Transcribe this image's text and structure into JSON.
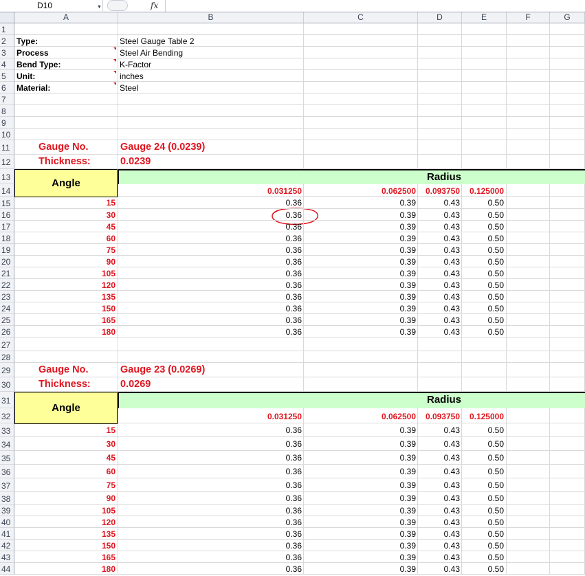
{
  "formula_bar": {
    "name_box": "D10",
    "fx_label": "fx"
  },
  "columns": [
    "A",
    "B",
    "C",
    "D",
    "E",
    "F",
    "G"
  ],
  "info": [
    {
      "label": "Type:",
      "value": "Steel Gauge Table 2",
      "flag": false
    },
    {
      "label": "Process",
      "value": "Steel Air Bending",
      "flag": true
    },
    {
      "label": "Bend Type:",
      "value": "K-Factor",
      "flag": true
    },
    {
      "label": "Unit:",
      "value": "inches",
      "flag": true
    },
    {
      "label": "Material:",
      "value": "Steel",
      "flag": true
    }
  ],
  "tables": [
    {
      "gauge_label": "Gauge No.",
      "gauge_value": "Gauge 24 (0.0239)",
      "thickness_label": "Thickness:",
      "thickness_value": "0.0239",
      "angle_header": "Angle",
      "radius_header": "Radius",
      "radii": [
        "0.031250",
        "0.062500",
        "0.093750",
        "0.125000"
      ],
      "angles": [
        "15",
        "30",
        "45",
        "60",
        "75",
        "90",
        "105",
        "120",
        "135",
        "150",
        "165",
        "180"
      ],
      "values": [
        "0.36",
        "0.39",
        "0.43",
        "0.50"
      ]
    },
    {
      "gauge_label": "Gauge No.",
      "gauge_value": "Gauge 23 (0.0269)",
      "thickness_label": "Thickness:",
      "thickness_value": "0.0269",
      "angle_header": "Angle",
      "radius_header": "Radius",
      "radii": [
        "0.031250",
        "0.062500",
        "0.093750",
        "0.125000"
      ],
      "angles": [
        "15",
        "30",
        "45",
        "60",
        "75",
        "90",
        "105",
        "120",
        "135",
        "150",
        "165",
        "180"
      ],
      "values": [
        "0.36",
        "0.39",
        "0.43",
        "0.50"
      ]
    }
  ],
  "annotation": {
    "type": "hand-drawn-circle",
    "color": "#e0141e"
  }
}
